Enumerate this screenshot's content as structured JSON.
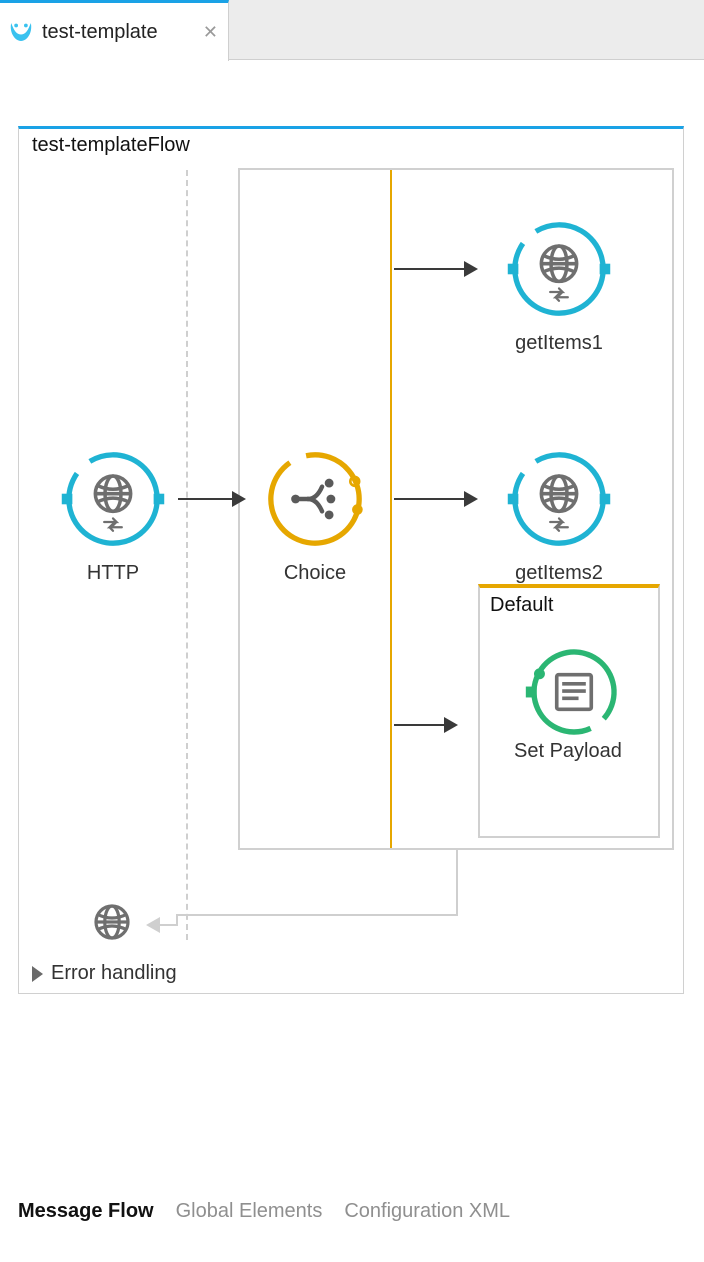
{
  "tab": {
    "label": "test-template"
  },
  "flow": {
    "title": "test-templateFlow"
  },
  "nodes": {
    "http": "HTTP",
    "choice": "Choice",
    "getItems1": "getItems1",
    "getItems2": "getItems2",
    "defaultBox": "Default",
    "setPayload": "Set Payload",
    "errorHandling": "Error handling"
  },
  "bottomTabs": {
    "messageFlow": "Message Flow",
    "globalElements": "Global Elements",
    "configXml": "Configuration XML"
  }
}
